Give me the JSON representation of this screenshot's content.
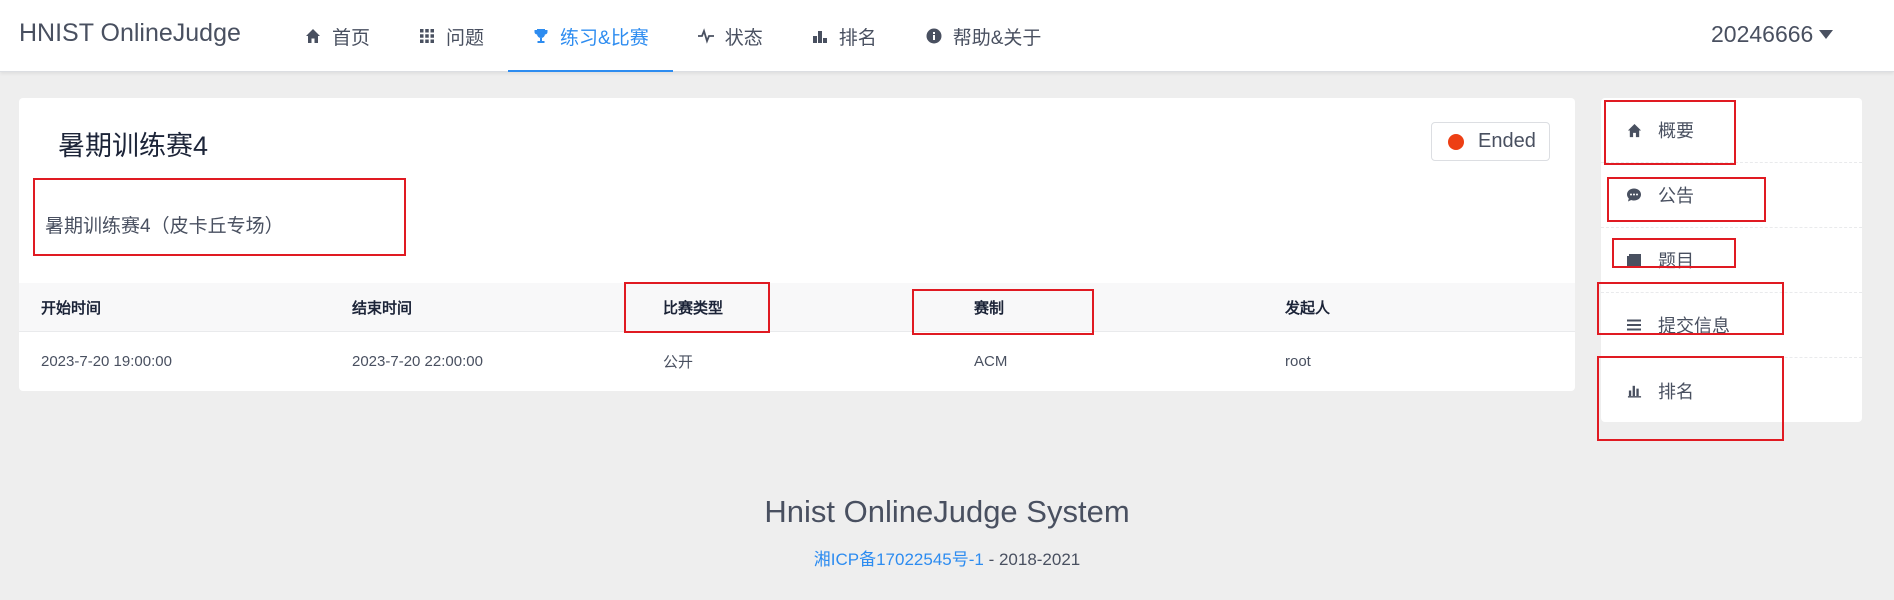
{
  "app": {
    "logo": "HNIST OnlineJudge"
  },
  "nav": {
    "items": [
      {
        "label": "首页",
        "icon": "home-icon"
      },
      {
        "label": "问题",
        "icon": "grid-icon"
      },
      {
        "label": "练习&比赛",
        "icon": "trophy-icon",
        "active": true
      },
      {
        "label": "状态",
        "icon": "pulse-icon"
      },
      {
        "label": "排名",
        "icon": "bar-chart-icon"
      },
      {
        "label": "帮助&关于",
        "icon": "info-icon"
      }
    ]
  },
  "user": {
    "name": "20246666"
  },
  "contest": {
    "title": "暑期训练赛4",
    "status": "Ended",
    "status_color": "#ed3f14",
    "description": "暑期训练赛4（皮卡丘专场）",
    "table": {
      "headers": [
        "开始时间",
        "结束时间",
        "比赛类型",
        "赛制",
        "发起人"
      ],
      "row": [
        "2023-7-20 19:00:00",
        "2023-7-20 22:00:00",
        "公开",
        "ACM",
        "root"
      ]
    }
  },
  "side_menu": {
    "items": [
      {
        "label": "概要",
        "icon": "home-icon"
      },
      {
        "label": "公告",
        "icon": "chat-icon"
      },
      {
        "label": "题目",
        "icon": "book-icon"
      },
      {
        "label": "提交信息",
        "icon": "list-icon"
      },
      {
        "label": "排名",
        "icon": "bar-chart-icon"
      }
    ]
  },
  "footer": {
    "title": "Hnist OnlineJudge System",
    "icp": "湘ICP备17022545号-1",
    "years": " - 2018-2021"
  },
  "colors": {
    "accent": "#2d8cf0",
    "annotation": "#e01a22"
  }
}
